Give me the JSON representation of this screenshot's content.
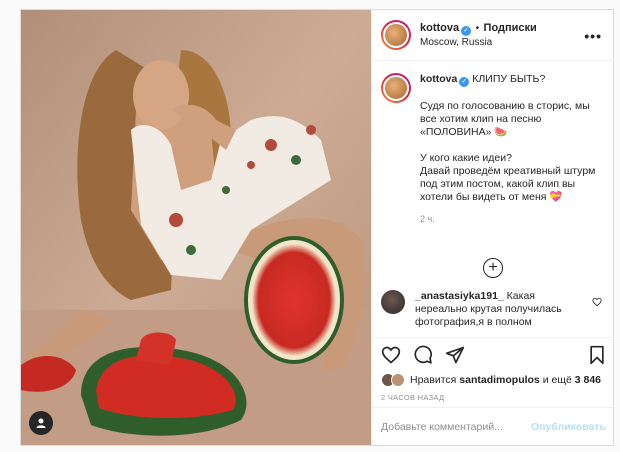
{
  "post": {
    "username": "kottova",
    "verified_glyph": "✓",
    "separator": "•",
    "follow_label": "Подписки",
    "location": "Moscow, Russia",
    "more_glyph": "•••",
    "user_tag_icon": "user-icon"
  },
  "caption": {
    "username": "kottova",
    "title": "КЛИПУ БЫТЬ?",
    "line1": "Судя по голосованию в сторис, мы все хотим клип на песню «ПОЛОВИНА» 🍉",
    "line2": "У кого какие идеи?",
    "line3": "Давай проведём креативный штурм под этим постом, какой клип вы хотели бы видеть от меня 💝",
    "time": "2 ч."
  },
  "load_more_glyph": "+",
  "comment": {
    "username": "_anastasiyka191_",
    "text": "Какая нереально крутая получилась фотография,я в полном"
  },
  "likes": {
    "prefix": "Нравится",
    "user": "santadimopulos",
    "middle": "и ещё",
    "count": "3 846"
  },
  "date": "2 ЧАСОВ НАЗАД",
  "add_comment": {
    "placeholder": "Добавьте комментарий...",
    "publish": "Опубликовать"
  },
  "colors": {
    "verified": "#3897f0",
    "publish_disabled": "#b2dffc",
    "secondary_text": "#8e8e8e"
  }
}
